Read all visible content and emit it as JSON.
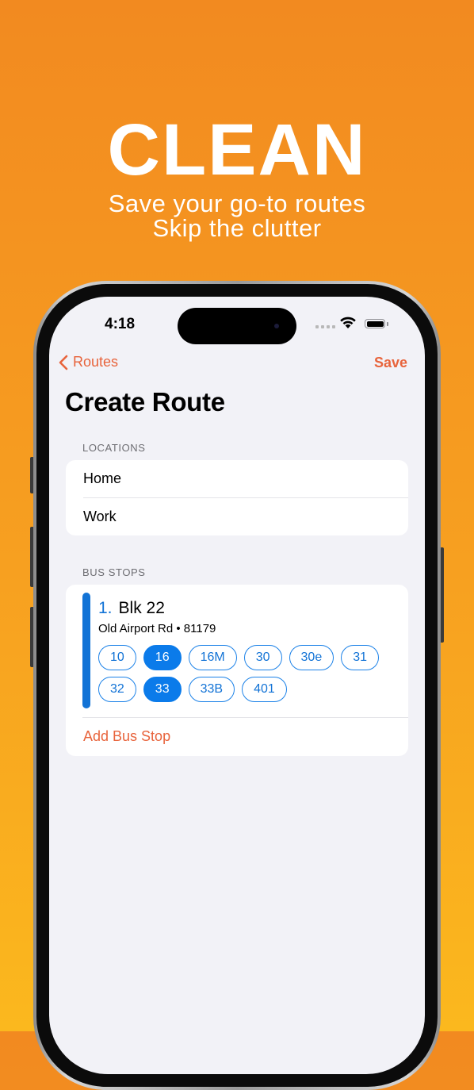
{
  "hero": {
    "title": "CLEAN",
    "subtitle_line1": "Save your go-to routes",
    "subtitle_line2": "Skip the clutter"
  },
  "status_bar": {
    "time": "4:18"
  },
  "nav": {
    "back_label": "Routes",
    "save_label": "Save"
  },
  "page": {
    "title": "Create Route"
  },
  "locations": {
    "section_label": "LOCATIONS",
    "items": [
      "Home",
      "Work"
    ]
  },
  "bus_stops": {
    "section_label": "BUS STOPS",
    "stops": [
      {
        "number": "1.",
        "name": "Blk 22",
        "subtitle": "Old Airport Rd • 81179",
        "services_row1": [
          {
            "label": "10",
            "selected": false
          },
          {
            "label": "16",
            "selected": true
          },
          {
            "label": "16M",
            "selected": false
          },
          {
            "label": "30",
            "selected": false
          },
          {
            "label": "30e",
            "selected": false
          },
          {
            "label": "31",
            "selected": false
          }
        ],
        "services_row2": [
          {
            "label": "32",
            "selected": false
          },
          {
            "label": "33",
            "selected": true
          },
          {
            "label": "33B",
            "selected": false
          },
          {
            "label": "401",
            "selected": false
          }
        ]
      }
    ],
    "add_label": "Add Bus Stop"
  },
  "colors": {
    "accent": "#E8643C",
    "stop_blue": "#1273D6",
    "selected_chip": "#0B7BEA",
    "background_top": "#F28A20",
    "background_bottom": "#FBB81E"
  }
}
